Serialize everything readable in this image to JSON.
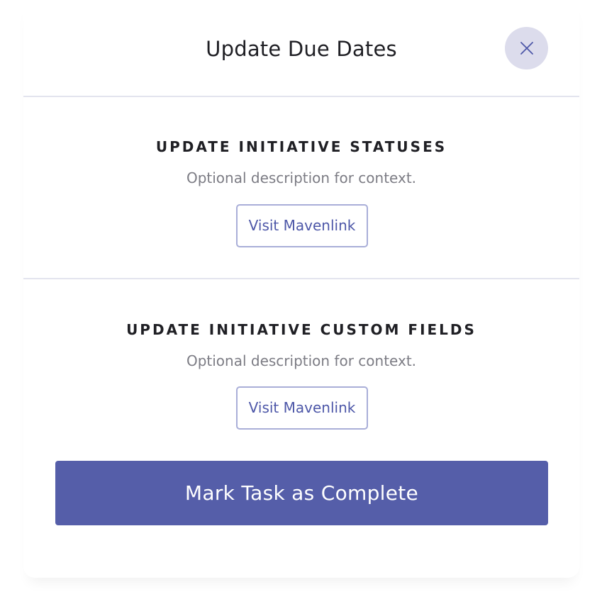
{
  "modal": {
    "title": "Update Due Dates",
    "close_icon": "close-icon"
  },
  "sections": [
    {
      "heading": "UPDATE INITIATIVE STATUSES",
      "description": "Optional description for context.",
      "button_label": "Visit Mavenlink"
    },
    {
      "heading": "UPDATE INITIATIVE CUSTOM FIELDS",
      "description": "Optional description for context.",
      "button_label": "Visit Mavenlink"
    }
  ],
  "footer": {
    "complete_label": "Mark Task as Complete"
  },
  "colors": {
    "accent": "#555ea9",
    "link": "#4d57a8",
    "button_border": "#a9aed8",
    "close_bg": "#dcdcec",
    "divider": "#e3e4ee"
  }
}
